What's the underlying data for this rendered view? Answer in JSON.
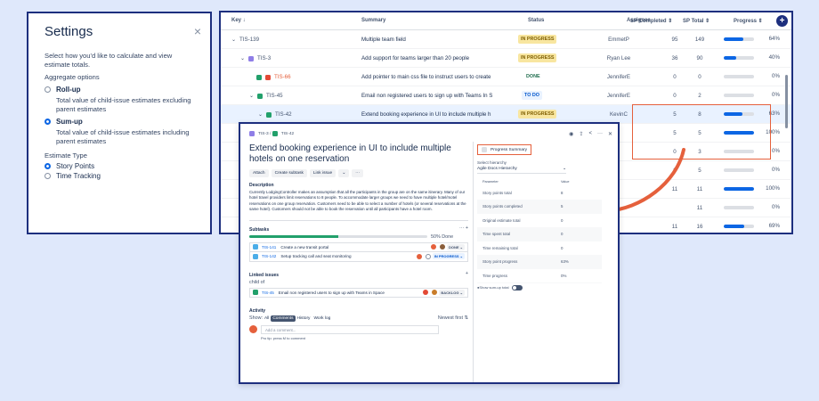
{
  "settings": {
    "title": "Settings",
    "close": "×",
    "description": "Select how you'd like to calculate and view estimate totals.",
    "aggregate_label": "Aggregate options",
    "rollup": {
      "label": "Roll-up",
      "desc": "Total value of child-issue estimates excluding parent estimates"
    },
    "sumup": {
      "label": "Sum-up",
      "desc": "Total value of child-issue estimates including parent estimates"
    },
    "estimate_label": "Estimate Type",
    "estimate_options": [
      "Story Points",
      "Time Tracking"
    ]
  },
  "table": {
    "headers": {
      "key": "Key ↓",
      "summary": "Summary",
      "status": "Status",
      "assignee": "Assignee",
      "sp_completed": "SP Completed ⇕",
      "sp_total": "SP Total ⇕",
      "progress": "Progress ⇕"
    },
    "add_column": "+",
    "rows": [
      {
        "key": "TIS-139",
        "summary": "Multiple team field",
        "status": "IN PROGRESS",
        "assignee": "EmmetP",
        "spc": "95",
        "spt": "149",
        "pct": "64%",
        "fill": 0.64
      },
      {
        "key": "TIS-3",
        "summary": "Add support for teams larger than 20 people",
        "status": "IN PROGRESS",
        "assignee": "Ryan Lee",
        "spc": "36",
        "spt": "90",
        "pct": "40%",
        "fill": 0.4
      },
      {
        "key": "TIS-66",
        "summary": "Add pointer to main css file to instruct users to create",
        "status": "DONE",
        "assignee": "JenniferE",
        "spc": "0",
        "spt": "0",
        "pct": "0%",
        "fill": 0
      },
      {
        "key": "TIS-45",
        "summary": "Email non registered users to sign up with Teams In S",
        "status": "TO DO",
        "assignee": "JenniferE",
        "spc": "0",
        "spt": "2",
        "pct": "0%",
        "fill": 0
      },
      {
        "key": "TIS-42",
        "summary": "Extend booking experience in UI to include multiple h",
        "status": "IN PROGRESS",
        "assignee": "KevinC",
        "spc": "5",
        "spt": "8",
        "pct": "63%",
        "fill": 0.63
      },
      {
        "key": "",
        "summary": "",
        "status": "",
        "assignee": "",
        "spc": "5",
        "spt": "5",
        "pct": "100%",
        "fill": 1.0
      },
      {
        "key": "",
        "summary": "",
        "status": "",
        "assignee": "",
        "spc": "0",
        "spt": "3",
        "pct": "0%",
        "fill": 0
      },
      {
        "key": "",
        "summary": "",
        "status": "",
        "assignee": "",
        "spc": "0",
        "spt": "5",
        "pct": "0%",
        "fill": 0
      },
      {
        "key": "",
        "summary": "",
        "status": "",
        "assignee": "",
        "spc": "11",
        "spt": "11",
        "pct": "100%",
        "fill": 1.0
      },
      {
        "key": "",
        "summary": "",
        "status": "",
        "assignee": "",
        "spc": "",
        "spt": "11",
        "pct": "0%",
        "fill": 0
      },
      {
        "key": "",
        "summary": "",
        "status": "",
        "assignee": "",
        "spc": "11",
        "spt": "16",
        "pct": "69%",
        "fill": 0.69
      }
    ]
  },
  "issue": {
    "crumb_parent": "TIS-3",
    "crumb_sep": "/",
    "crumb_key": "TIS-42",
    "title": "Extend booking experience in UI to include multiple hotels on one reservation",
    "actions": [
      "Attach",
      "Create subtask",
      "Link issue",
      "⌄",
      "···"
    ],
    "desc_label": "Description",
    "description": "Currently LodgingController makes an assumption that all the participants in the group are on the same itinerary. Many of our hotel travel providers limit reservations to 8 people. To accommodate larger groups we need to have multiple hotel/motel reservations on one group reservation. Customers need to be able to select a number of hotels (or several reservations at the same hotel). Customers should not be able to book the reservation until all participants have a hotel room.",
    "subtasks_label": "Subtasks",
    "subtasks_done": "50% Done",
    "subtasks": [
      {
        "key": "TIS-141",
        "title": "Create a new transit portal",
        "status": "DONE ⌄"
      },
      {
        "key": "TIS-142",
        "title": "Setup tracking call and seat monitoring",
        "status": "IN PROGRESS ⌄"
      }
    ],
    "linked_label": "Linked issues",
    "linked_sub": "child of",
    "linked": {
      "key": "TIS-45",
      "title": "Email non registered users to sign up with Teams in Space",
      "status": "BACKLOG ⌄"
    },
    "activity_label": "Activity",
    "show": "Show:",
    "activity_tabs": [
      "All",
      "Comments",
      "History",
      "Work log"
    ],
    "newest": "Newest first ⇅",
    "comment_placeholder": "Add a comment...",
    "protip": "Pro tip: press M to comment"
  },
  "panel": {
    "tools": [
      "◉",
      "⇪",
      "<",
      "···",
      "✕"
    ],
    "title": "Progress Summary",
    "select_label": "Select hierarchy",
    "select_value": "Agile Docs Hierarchy",
    "col_param": "Parameter",
    "col_value": "Value",
    "params": [
      {
        "name": "Story points total",
        "value": "8"
      },
      {
        "name": "Story points completed",
        "value": "5"
      },
      {
        "name": "Original estimate total",
        "value": "0"
      },
      {
        "name": "Time spent total",
        "value": "0"
      },
      {
        "name": "Time remaining total",
        "value": "0"
      },
      {
        "name": "Story point progress",
        "value": "63%"
      },
      {
        "name": "Time progress",
        "value": "0%"
      }
    ],
    "toggle_label": "Show sum-up total"
  }
}
